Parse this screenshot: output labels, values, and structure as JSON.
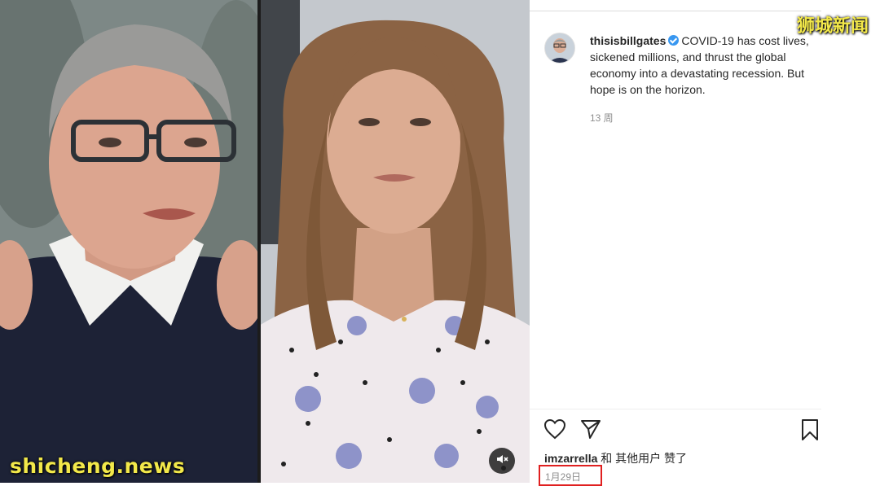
{
  "watermarks": {
    "top_right": "狮城新闻",
    "bottom_left": "shicheng.news"
  },
  "video": {
    "mute_icon": "speaker-muted-icon"
  },
  "post": {
    "username": "thisisbillgates",
    "verified": true,
    "caption": "COVID-19 has cost lives, sickened millions, and thrust the global economy into a devastating recession. But hope is on the horizon.",
    "time_ago": "13 周",
    "actions": {
      "like_icon": "heart-icon",
      "share_icon": "paper-plane-icon",
      "save_icon": "bookmark-icon"
    },
    "likes": {
      "user": "imzarrella",
      "suffix": " 和 其他用户 赞了"
    },
    "date": "1月29日"
  },
  "colors": {
    "watermark": "#f2e84a",
    "verified_badge": "#3897f0",
    "highlight_box": "#e02020"
  }
}
